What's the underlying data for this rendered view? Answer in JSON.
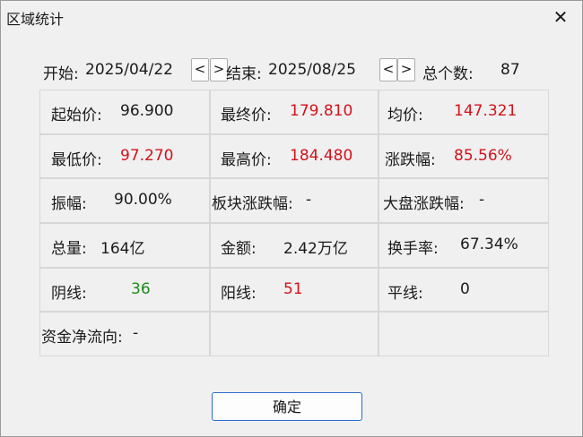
{
  "window": {
    "title": "区域统计",
    "close_glyph": "✕"
  },
  "range": {
    "start_label": "开始:",
    "start_date": "2025/04/22",
    "prev_glyph": "<",
    "next_glyph": ">",
    "end_label": "结束:",
    "end_date": "2025/08/25",
    "count_label": "总个数:",
    "count_value": "87"
  },
  "stats": {
    "start_price_label": "起始价:",
    "start_price": "96.900",
    "end_price_label": "最终价:",
    "end_price": "179.810",
    "avg_price_label": "均价:",
    "avg_price": "147.321",
    "low_price_label": "最低价:",
    "low_price": "97.270",
    "high_price_label": "最高价:",
    "high_price": "184.480",
    "change_pct_label": "涨跌幅:",
    "change_pct": "85.56%",
    "amplitude_label": "振幅:",
    "amplitude": "90.00%",
    "sector_change_label": "板块涨跌幅:",
    "sector_change": "-",
    "market_change_label": "大盘涨跌幅:",
    "market_change": "-",
    "volume_label": "总量:",
    "volume": "164亿",
    "amount_label": "金额:",
    "amount": "2.42万亿",
    "turnover_label": "换手率:",
    "turnover": "67.34%",
    "down_days_label": "阴线:",
    "down_days": "36",
    "up_days_label": "阳线:",
    "up_days": "51",
    "flat_days_label": "平线:",
    "flat_days": "0",
    "net_flow_label": "资金净流向:",
    "net_flow": "-"
  },
  "buttons": {
    "ok_label": "确定"
  },
  "colors": {
    "up": "#d4121c",
    "down": "#1a8c1a",
    "text": "#1a1a1a"
  }
}
